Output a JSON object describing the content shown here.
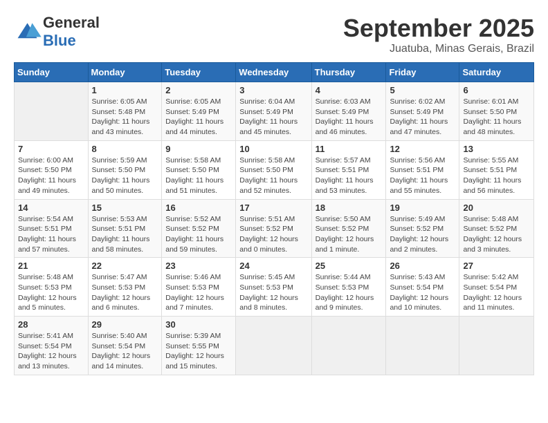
{
  "header": {
    "logo_general": "General",
    "logo_blue": "Blue",
    "month_title": "September 2025",
    "location": "Juatuba, Minas Gerais, Brazil"
  },
  "days_of_week": [
    "Sunday",
    "Monday",
    "Tuesday",
    "Wednesday",
    "Thursday",
    "Friday",
    "Saturday"
  ],
  "weeks": [
    [
      {
        "day": "",
        "info": ""
      },
      {
        "day": "1",
        "info": "Sunrise: 6:05 AM\nSunset: 5:48 PM\nDaylight: 11 hours\nand 43 minutes."
      },
      {
        "day": "2",
        "info": "Sunrise: 6:05 AM\nSunset: 5:49 PM\nDaylight: 11 hours\nand 44 minutes."
      },
      {
        "day": "3",
        "info": "Sunrise: 6:04 AM\nSunset: 5:49 PM\nDaylight: 11 hours\nand 45 minutes."
      },
      {
        "day": "4",
        "info": "Sunrise: 6:03 AM\nSunset: 5:49 PM\nDaylight: 11 hours\nand 46 minutes."
      },
      {
        "day": "5",
        "info": "Sunrise: 6:02 AM\nSunset: 5:49 PM\nDaylight: 11 hours\nand 47 minutes."
      },
      {
        "day": "6",
        "info": "Sunrise: 6:01 AM\nSunset: 5:50 PM\nDaylight: 11 hours\nand 48 minutes."
      }
    ],
    [
      {
        "day": "7",
        "info": "Sunrise: 6:00 AM\nSunset: 5:50 PM\nDaylight: 11 hours\nand 49 minutes."
      },
      {
        "day": "8",
        "info": "Sunrise: 5:59 AM\nSunset: 5:50 PM\nDaylight: 11 hours\nand 50 minutes."
      },
      {
        "day": "9",
        "info": "Sunrise: 5:58 AM\nSunset: 5:50 PM\nDaylight: 11 hours\nand 51 minutes."
      },
      {
        "day": "10",
        "info": "Sunrise: 5:58 AM\nSunset: 5:50 PM\nDaylight: 11 hours\nand 52 minutes."
      },
      {
        "day": "11",
        "info": "Sunrise: 5:57 AM\nSunset: 5:51 PM\nDaylight: 11 hours\nand 53 minutes."
      },
      {
        "day": "12",
        "info": "Sunrise: 5:56 AM\nSunset: 5:51 PM\nDaylight: 11 hours\nand 55 minutes."
      },
      {
        "day": "13",
        "info": "Sunrise: 5:55 AM\nSunset: 5:51 PM\nDaylight: 11 hours\nand 56 minutes."
      }
    ],
    [
      {
        "day": "14",
        "info": "Sunrise: 5:54 AM\nSunset: 5:51 PM\nDaylight: 11 hours\nand 57 minutes."
      },
      {
        "day": "15",
        "info": "Sunrise: 5:53 AM\nSunset: 5:51 PM\nDaylight: 11 hours\nand 58 minutes."
      },
      {
        "day": "16",
        "info": "Sunrise: 5:52 AM\nSunset: 5:52 PM\nDaylight: 11 hours\nand 59 minutes."
      },
      {
        "day": "17",
        "info": "Sunrise: 5:51 AM\nSunset: 5:52 PM\nDaylight: 12 hours\nand 0 minutes."
      },
      {
        "day": "18",
        "info": "Sunrise: 5:50 AM\nSunset: 5:52 PM\nDaylight: 12 hours\nand 1 minute."
      },
      {
        "day": "19",
        "info": "Sunrise: 5:49 AM\nSunset: 5:52 PM\nDaylight: 12 hours\nand 2 minutes."
      },
      {
        "day": "20",
        "info": "Sunrise: 5:48 AM\nSunset: 5:52 PM\nDaylight: 12 hours\nand 3 minutes."
      }
    ],
    [
      {
        "day": "21",
        "info": "Sunrise: 5:48 AM\nSunset: 5:53 PM\nDaylight: 12 hours\nand 5 minutes."
      },
      {
        "day": "22",
        "info": "Sunrise: 5:47 AM\nSunset: 5:53 PM\nDaylight: 12 hours\nand 6 minutes."
      },
      {
        "day": "23",
        "info": "Sunrise: 5:46 AM\nSunset: 5:53 PM\nDaylight: 12 hours\nand 7 minutes."
      },
      {
        "day": "24",
        "info": "Sunrise: 5:45 AM\nSunset: 5:53 PM\nDaylight: 12 hours\nand 8 minutes."
      },
      {
        "day": "25",
        "info": "Sunrise: 5:44 AM\nSunset: 5:53 PM\nDaylight: 12 hours\nand 9 minutes."
      },
      {
        "day": "26",
        "info": "Sunrise: 5:43 AM\nSunset: 5:54 PM\nDaylight: 12 hours\nand 10 minutes."
      },
      {
        "day": "27",
        "info": "Sunrise: 5:42 AM\nSunset: 5:54 PM\nDaylight: 12 hours\nand 11 minutes."
      }
    ],
    [
      {
        "day": "28",
        "info": "Sunrise: 5:41 AM\nSunset: 5:54 PM\nDaylight: 12 hours\nand 13 minutes."
      },
      {
        "day": "29",
        "info": "Sunrise: 5:40 AM\nSunset: 5:54 PM\nDaylight: 12 hours\nand 14 minutes."
      },
      {
        "day": "30",
        "info": "Sunrise: 5:39 AM\nSunset: 5:55 PM\nDaylight: 12 hours\nand 15 minutes."
      },
      {
        "day": "",
        "info": ""
      },
      {
        "day": "",
        "info": ""
      },
      {
        "day": "",
        "info": ""
      },
      {
        "day": "",
        "info": ""
      }
    ]
  ]
}
